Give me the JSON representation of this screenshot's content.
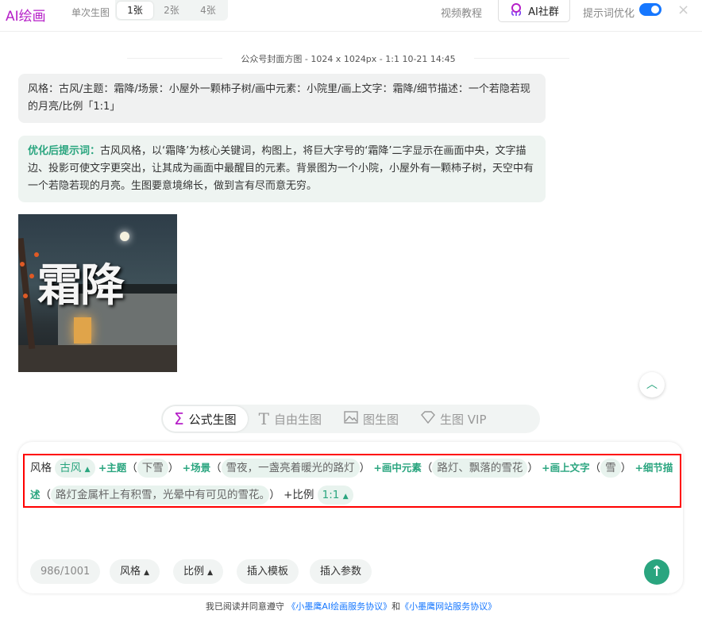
{
  "header": {
    "logo": "AI绘画",
    "single_label": "单次生图",
    "counts": [
      "1张",
      "2张",
      "4张"
    ],
    "selected_count": "1张",
    "video_tutorial": "视频教程",
    "community": "AI社群",
    "prompt_opt_label": "提示词优化",
    "prompt_opt_on": true,
    "close": "×"
  },
  "chat": {
    "meta": "公众号封面方图 - 1024 x 1024px - 1:1    10-21 14:45",
    "user_prompt": "风格：古风/主题：霜降/场景：小屋外一颗柿子树/画中元素：小院里/画上文字：霜降/细节描述：一个若隐若现的月亮/比例「1:1」",
    "optimized_label": "优化后提示词：",
    "optimized_text": "古风风格，以‘霜降’为核心关键词，构图上，将巨大字号的‘霜降’二字显示在画面中央，文字描边、投影可使文字更突出，让其成为画面中最醒目的元素。背景图为一个小院，小屋外有一颗柿子树，天空中有一个若隐若现的月亮。生图要意境绵长，做到言有尽而意无穷。",
    "image_text": "霜降"
  },
  "tabs": [
    {
      "label": "公式生图",
      "icon": "sigma-icon"
    },
    {
      "label": "自由生图",
      "icon": "text-icon"
    },
    {
      "label": "图生图",
      "icon": "image-icon"
    },
    {
      "label": "生图 VIP",
      "icon": "diamond-icon"
    }
  ],
  "formula": {
    "style_label": "风格",
    "style_value": "古风",
    "theme_label": "+主题",
    "theme_value": "下雪",
    "scene_label": "+场景",
    "scene_value": "雪夜，一盏亮着暖光的路灯",
    "elements_label": "+画中元素",
    "elements_value": "路灯、飘落的雪花",
    "text_label": "+画上文字",
    "text_value": "雪",
    "detail_label": "+细节描述",
    "detail_value": "路灯金属杆上有积雪，光晕中有可见的雪花。",
    "ratio_label": "+比例",
    "ratio_value": "1:1",
    "open_paren": "（",
    "close_paren": "）"
  },
  "toolbar": {
    "counter": "986/1001",
    "style": "风格",
    "ratio": "比例",
    "insert_template": "插入模板",
    "insert_param": "插入参数"
  },
  "footer": {
    "prefix": "我已阅读并同意遵守 ",
    "link1": "《小墨鹰AI绘画服务协议》",
    "and": "和",
    "link2": "《小墨鹰网站服务协议》"
  },
  "colors": {
    "accent": "#2aa57f",
    "brand": "#b620c8",
    "toggle": "#1677ff",
    "highlight": "#ff0000"
  }
}
